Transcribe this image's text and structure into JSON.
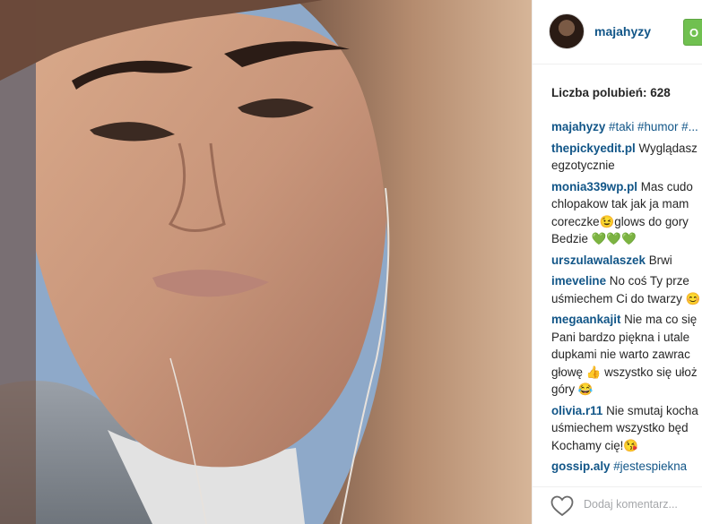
{
  "post": {
    "username": "majahyzy",
    "follow_label": "O",
    "likes_label": "Liczba polubień: 628",
    "add_comment_placeholder": "Dodaj komentarz..."
  },
  "comments": [
    {
      "user": "majahyzy",
      "lines": [
        "#taki #humor #..."
      ],
      "hashtags": true
    },
    {
      "user": "thepickyedit.pl",
      "lines": [
        "Wyglądasz",
        "egzotycznie"
      ]
    },
    {
      "user": "monia339wp.pl",
      "lines": [
        "Mas cudo",
        "chlopakow tak jak ja mam",
        "coreczke😉glows do gory",
        "Bedzie 💚💚💚"
      ]
    },
    {
      "user": "urszulawalaszek",
      "lines": [
        "Brwi"
      ]
    },
    {
      "user": "imeveline",
      "lines": [
        "No coś Ty prze",
        "uśmiechem Ci do twarzy 😊"
      ]
    },
    {
      "user": "megaankajit",
      "lines": [
        "Nie ma co się",
        "Pani bardzo piękna i utale",
        "dupkami nie warto zawrac",
        "głowę 👍 wszystko się ułoż",
        "góry 😂"
      ]
    },
    {
      "user": "olivia.r11",
      "lines": [
        "Nie smutaj kocha",
        "uśmiechem wszystko będ",
        "Kochamy cię!😘"
      ]
    },
    {
      "user": "gossip.aly",
      "lines": [
        "#jestespiekna"
      ],
      "hashtags": true
    }
  ],
  "colors": {
    "username_blue": "#125688",
    "follow_green": "#70c050",
    "muted_gray": "#a5a7aa"
  },
  "icons": {
    "like": "heart-outline-icon"
  }
}
